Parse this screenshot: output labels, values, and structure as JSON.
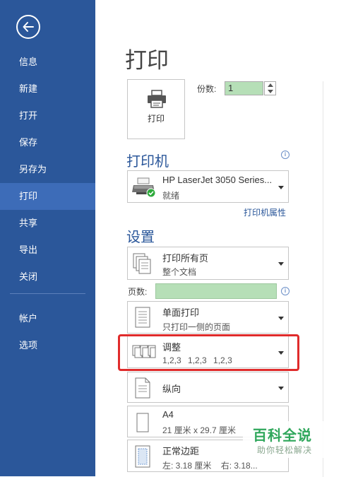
{
  "sidebar": {
    "items": [
      {
        "label": "信息"
      },
      {
        "label": "新建"
      },
      {
        "label": "打开"
      },
      {
        "label": "保存"
      },
      {
        "label": "另存为"
      },
      {
        "label": "打印"
      },
      {
        "label": "共享"
      },
      {
        "label": "导出"
      },
      {
        "label": "关闭"
      },
      {
        "label": "帐户"
      },
      {
        "label": "选项"
      }
    ],
    "active": "打印",
    "color": "#2b579a",
    "active_color": "#3d6cb8"
  },
  "page": {
    "title": "打印"
  },
  "print_button": {
    "label": "打印",
    "icon": "printer-icon"
  },
  "copies": {
    "label": "份数:",
    "value": "1",
    "field_color": "#b6dfb7"
  },
  "printer": {
    "heading": "打印机",
    "name": "HP LaserJet 3050 Series...",
    "status": "就绪",
    "properties_link": "打印机属性"
  },
  "settings": {
    "heading": "设置",
    "range": {
      "title": "打印所有页",
      "subtitle": "整个文档"
    },
    "pages_label": "页数:",
    "sides": {
      "title": "单面打印",
      "subtitle": "只打印一侧的页面"
    },
    "collate": {
      "title": "调整",
      "subtitle": "1,2,3    1,2,3    1,2,3"
    },
    "orientation": {
      "title": "纵向"
    },
    "paper": {
      "title": "A4",
      "subtitle": "21 厘米 x 29.7 厘米"
    },
    "margins": {
      "title": "正常边距",
      "subtitle": "左: 3.18 厘米    右: 3.18..."
    }
  },
  "watermark": {
    "title": "百科全说",
    "subtitle": "助你轻松解决"
  },
  "highlight_color": "#e02b2b"
}
